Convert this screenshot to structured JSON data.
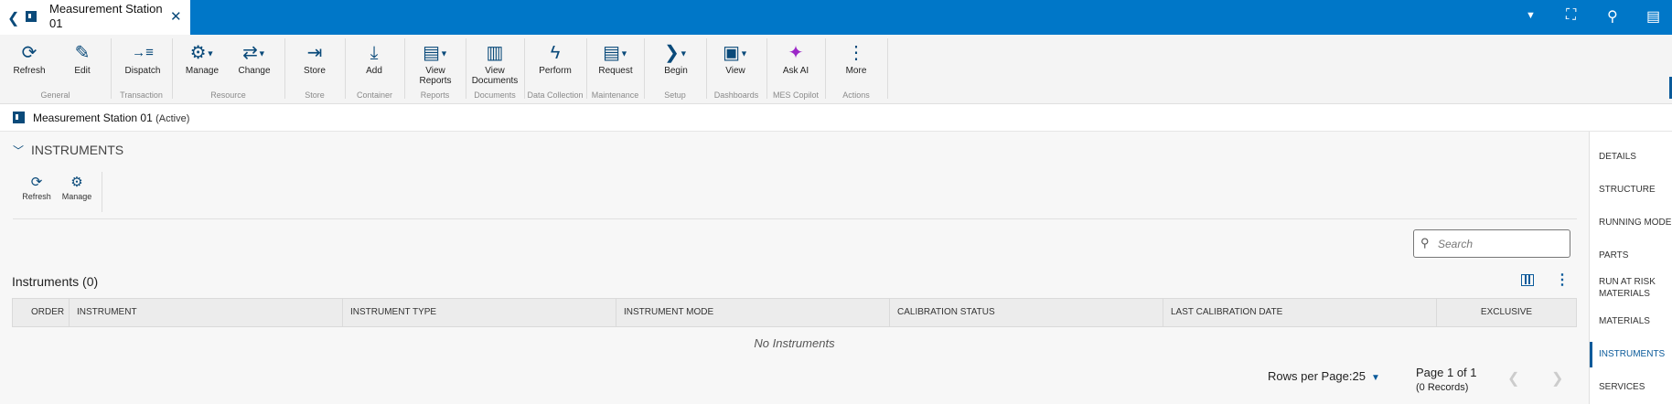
{
  "tab": {
    "title": "Measurement Station 01"
  },
  "ribbon": {
    "buttons": [
      {
        "label": "Refresh",
        "icon": "refresh-icon",
        "glyph": "⟳"
      },
      {
        "label": "Edit",
        "icon": "pencil-icon",
        "glyph": "✎"
      },
      {
        "label": "Dispatch",
        "icon": "dispatch-icon",
        "glyph": "→≡"
      },
      {
        "label": "Manage",
        "icon": "gear-icon",
        "glyph": "⚙"
      },
      {
        "label": "Change",
        "icon": "change-icon",
        "glyph": "⇄"
      },
      {
        "label": "Store",
        "icon": "store-icon",
        "glyph": "⇥"
      },
      {
        "label": "Add",
        "icon": "add-icon",
        "glyph": "⤓"
      },
      {
        "label": "View Reports",
        "icon": "reports-icon",
        "glyph": "▤"
      },
      {
        "label": "View Documents",
        "icon": "documents-icon",
        "glyph": "▥"
      },
      {
        "label": "Perform",
        "icon": "lightning-icon",
        "glyph": "ϟ"
      },
      {
        "label": "Request",
        "icon": "request-icon",
        "glyph": "▤"
      },
      {
        "label": "Begin",
        "icon": "chevron-right-icon",
        "glyph": "❯"
      },
      {
        "label": "View",
        "icon": "dashboard-icon",
        "glyph": "▣"
      },
      {
        "label": "Ask AI",
        "icon": "sparkle-icon",
        "glyph": "✦"
      },
      {
        "label": "More",
        "icon": "more-vertical-icon",
        "glyph": "⋮"
      }
    ],
    "groups": [
      "General",
      "Transaction",
      "Resource",
      "Store",
      "Container",
      "Reports",
      "Documents",
      "Data Collection",
      "Maintenance",
      "Setup",
      "Dashboards",
      "MES Copilot",
      "Actions"
    ]
  },
  "entity": {
    "name": "Measurement Station 01",
    "status": "(Active)"
  },
  "section": {
    "title": "INSTRUMENTS",
    "buttons": [
      {
        "label": "Refresh",
        "glyph": "⟳"
      },
      {
        "label": "Manage",
        "glyph": "⚙"
      }
    ]
  },
  "search": {
    "placeholder": "Search"
  },
  "table": {
    "title": "Instruments (0)",
    "columns": [
      "ORDER",
      "INSTRUMENT",
      "INSTRUMENT TYPE",
      "INSTRUMENT MODE",
      "CALIBRATION STATUS",
      "LAST CALIBRATION DATE",
      "EXCLUSIVE"
    ],
    "empty_text": "No Instruments"
  },
  "pagination": {
    "rows_per_page_label": "Rows per Page:",
    "rows_per_page": "25",
    "page_info": "Page 1 of 1",
    "records": "(0 Records)"
  },
  "right_nav": [
    {
      "label": "DETAILS",
      "active": false
    },
    {
      "label": "STRUCTURE",
      "active": false
    },
    {
      "label": "RUNNING MODES",
      "active": false
    },
    {
      "label": "PARTS",
      "active": false
    },
    {
      "label": "RUN AT RISK MATERIALS",
      "active": false
    },
    {
      "label": "MATERIALS",
      "active": false
    },
    {
      "label": "INSTRUMENTS",
      "active": true
    },
    {
      "label": "SERVICES",
      "active": false
    }
  ]
}
